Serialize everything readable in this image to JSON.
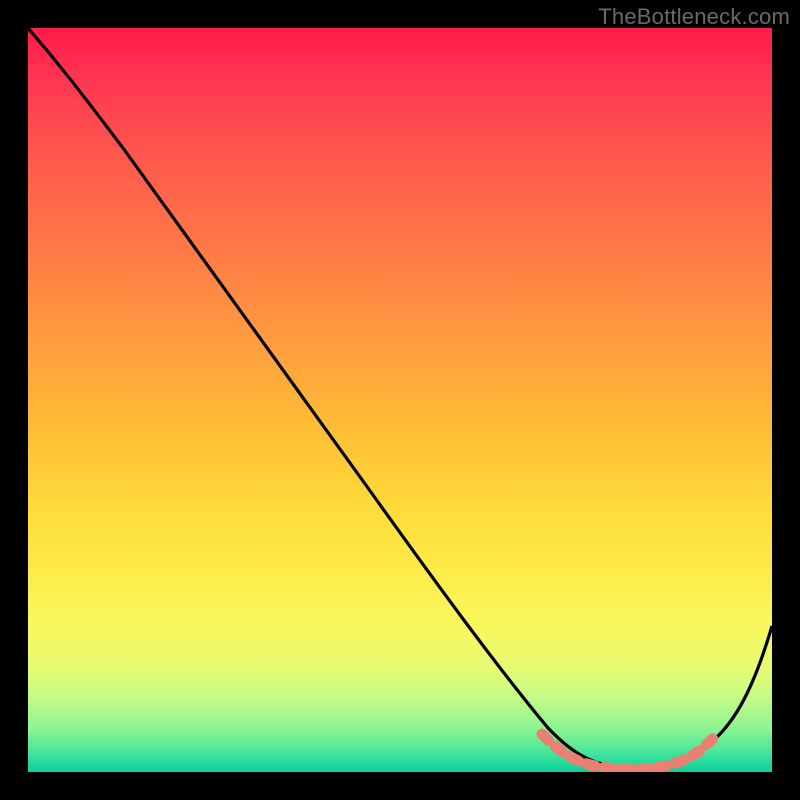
{
  "attribution": "TheBottleneck.com",
  "chart_data": {
    "type": "line",
    "title": "",
    "xlabel": "",
    "ylabel": "",
    "xlim": [
      0,
      100
    ],
    "ylim": [
      0,
      100
    ],
    "series": [
      {
        "name": "curve",
        "x": [
          0,
          8,
          20,
          30,
          40,
          50,
          60,
          67,
          72,
          76,
          80,
          84,
          88,
          92,
          96,
          100
        ],
        "values": [
          100,
          93,
          80,
          69,
          58,
          46,
          35,
          25,
          16,
          9,
          4,
          1,
          1,
          4,
          11,
          22
        ]
      },
      {
        "name": "marker-band",
        "x_start": 70,
        "x_end": 92,
        "y": 2
      }
    ],
    "gradient_stops": [
      {
        "pos": 0,
        "color": "#ff1a4b"
      },
      {
        "pos": 18,
        "color": "#ff5a4e"
      },
      {
        "pos": 42,
        "color": "#ff9c3f"
      },
      {
        "pos": 64,
        "color": "#ffd93a"
      },
      {
        "pos": 80,
        "color": "#f9f75c"
      },
      {
        "pos": 94,
        "color": "#8ff592"
      },
      {
        "pos": 100,
        "color": "#0cce9d"
      }
    ]
  }
}
